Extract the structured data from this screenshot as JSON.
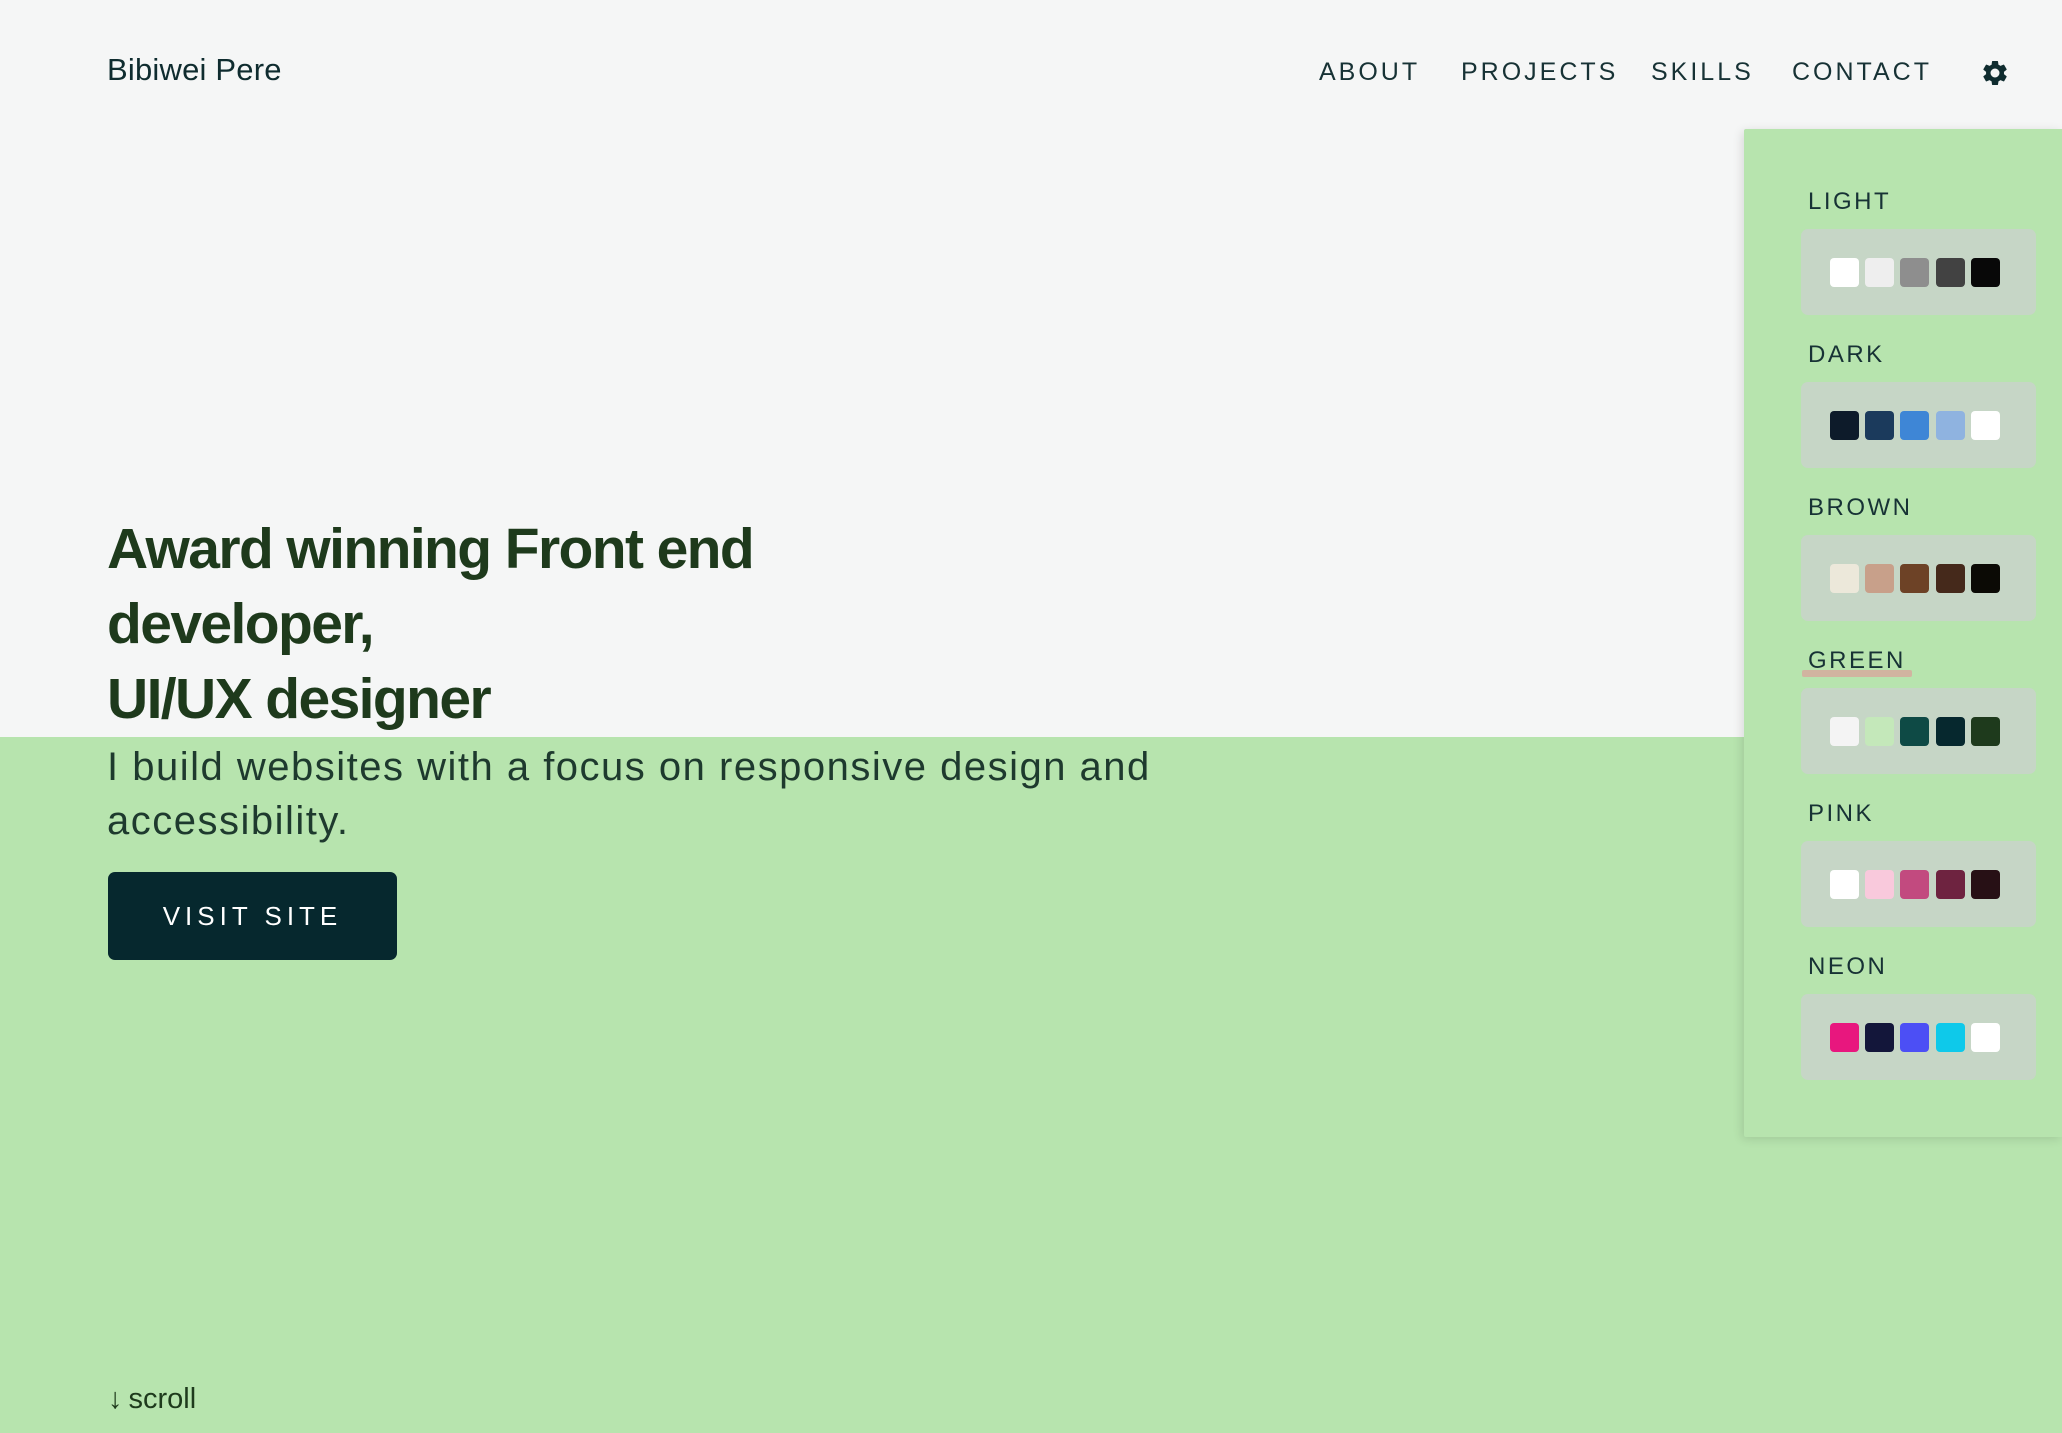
{
  "header": {
    "brand": "Bibiwei Pere",
    "nav": [
      "ABOUT",
      "PROJECTS",
      "SKILLS",
      "CONTACT"
    ],
    "settings_icon": "gear-icon"
  },
  "hero": {
    "title_lines": [
      "Award winning Front end",
      "developer,",
      "UI/UX designer"
    ],
    "subtitle": "I build websites with a focus on responsive design and accessibility.",
    "cta_label": "VISIT SITE",
    "scroll_label": "scroll",
    "scroll_icon": "arrow-down-icon"
  },
  "theme_panel": {
    "active": "GREEN",
    "themes": [
      {
        "name": "LIGHT",
        "colors": [
          "#ffffff",
          "#eeeeee",
          "#8e8e8e",
          "#424242",
          "#080808"
        ]
      },
      {
        "name": "DARK",
        "colors": [
          "#0d1b2a",
          "#1b3a5c",
          "#3e86d6",
          "#8fb3e0",
          "#ffffff"
        ]
      },
      {
        "name": "BROWN",
        "colors": [
          "#ece8da",
          "#c8a08a",
          "#6d4226",
          "#45291b",
          "#0b0a05"
        ]
      },
      {
        "name": "GREEN",
        "colors": [
          "#f4f4f4",
          "#c4e8ba",
          "#0e4a45",
          "#06282e",
          "#1e3a1c"
        ]
      },
      {
        "name": "PINK",
        "colors": [
          "#ffffff",
          "#f9c9dc",
          "#c24a7f",
          "#6e2340",
          "#271015"
        ]
      },
      {
        "name": "NEON",
        "colors": [
          "#e8177e",
          "#13163a",
          "#4c4ff5",
          "#0ec9ea",
          "#ffffff"
        ]
      }
    ]
  },
  "colors": {
    "top_background": "#f5f6f6",
    "bottom_background": "#b7e4ae",
    "heading": "#1e3a1c",
    "button": "#06282e",
    "active_underline": "#e88c96"
  }
}
